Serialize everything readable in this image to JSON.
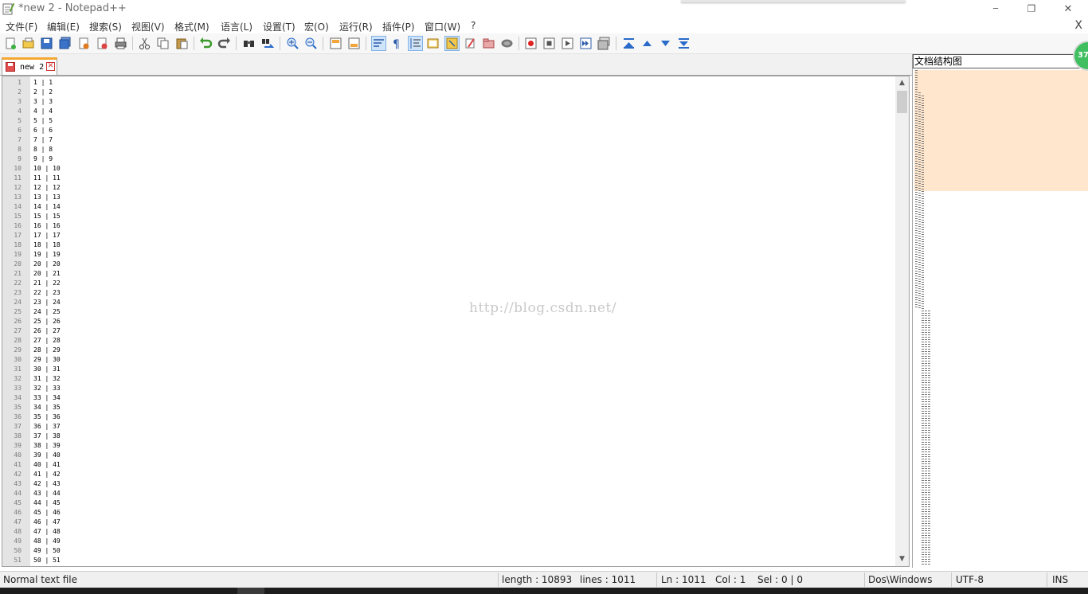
{
  "window": {
    "title": "*new 2 - Notepad++",
    "minimize_symbol": "─",
    "restore_symbol": "❐",
    "close_symbol": "✕"
  },
  "menu": {
    "items": [
      "文件(F)",
      "编辑(E)",
      "搜索(S)",
      "视图(V)",
      "格式(M)",
      "语言(L)",
      "设置(T)",
      "宏(O)",
      "运行(R)",
      "插件(P)",
      "窗口(W)",
      "?"
    ],
    "close_label": "X"
  },
  "toolbar": {
    "icons": [
      "new-file-icon",
      "open-file-icon",
      "save-icon",
      "save-all-icon",
      "close-icon",
      "close-all-icon",
      "print-icon",
      "cut-icon",
      "copy-icon",
      "paste-icon",
      "undo-icon",
      "redo-icon",
      "find-icon",
      "replace-icon",
      "zoom-in-icon",
      "zoom-out-icon",
      "sync-vertical-icon",
      "sync-horizontal-icon",
      "word-wrap-icon",
      "show-all-chars-icon",
      "indent-guide-icon",
      "doc-map-icon",
      "function-list-icon",
      "folder-workspace-icon",
      "monitor-icon",
      "record-macro-icon",
      "stop-macro-icon",
      "play-macro-icon",
      "run-macro-multiple-icon",
      "save-macro-icon",
      "collapse-icon",
      "prev-icon",
      "next-icon",
      "expand-icon"
    ],
    "active": [
      "word-wrap-icon",
      "indent-guide-icon",
      "doc-map-icon"
    ]
  },
  "tab": {
    "label": "new 2",
    "close_symbol": "✕"
  },
  "editor": {
    "lines": [
      {
        "n": "1",
        "t": "1 | 1"
      },
      {
        "n": "2",
        "t": "2 | 2"
      },
      {
        "n": "3",
        "t": "3 | 3"
      },
      {
        "n": "4",
        "t": "4 | 4"
      },
      {
        "n": "5",
        "t": "5 | 5"
      },
      {
        "n": "6",
        "t": "6 | 6"
      },
      {
        "n": "7",
        "t": "7 | 7"
      },
      {
        "n": "8",
        "t": "8 | 8"
      },
      {
        "n": "9",
        "t": "9 | 9"
      },
      {
        "n": "10",
        "t": "10 | 10"
      },
      {
        "n": "11",
        "t": "11 | 11"
      },
      {
        "n": "12",
        "t": "12 | 12"
      },
      {
        "n": "13",
        "t": "13 | 13"
      },
      {
        "n": "14",
        "t": "14 | 14"
      },
      {
        "n": "15",
        "t": "15 | 15"
      },
      {
        "n": "16",
        "t": "16 | 16"
      },
      {
        "n": "17",
        "t": "17 | 17"
      },
      {
        "n": "18",
        "t": "18 | 18"
      },
      {
        "n": "19",
        "t": "19 | 19"
      },
      {
        "n": "20",
        "t": "20 | 20"
      },
      {
        "n": "21",
        "t": "20 | 21"
      },
      {
        "n": "22",
        "t": "21 | 22"
      },
      {
        "n": "23",
        "t": "22 | 23"
      },
      {
        "n": "24",
        "t": "23 | 24"
      },
      {
        "n": "25",
        "t": "24 | 25"
      },
      {
        "n": "26",
        "t": "25 | 26"
      },
      {
        "n": "27",
        "t": "26 | 27"
      },
      {
        "n": "28",
        "t": "27 | 28"
      },
      {
        "n": "29",
        "t": "28 | 29"
      },
      {
        "n": "30",
        "t": "29 | 30"
      },
      {
        "n": "31",
        "t": "30 | 31"
      },
      {
        "n": "32",
        "t": "31 | 32"
      },
      {
        "n": "33",
        "t": "32 | 33"
      },
      {
        "n": "34",
        "t": "33 | 34"
      },
      {
        "n": "35",
        "t": "34 | 35"
      },
      {
        "n": "36",
        "t": "35 | 36"
      },
      {
        "n": "37",
        "t": "36 | 37"
      },
      {
        "n": "38",
        "t": "37 | 38"
      },
      {
        "n": "39",
        "t": "38 | 39"
      },
      {
        "n": "40",
        "t": "39 | 40"
      },
      {
        "n": "41",
        "t": "40 | 41"
      },
      {
        "n": "42",
        "t": "41 | 42"
      },
      {
        "n": "43",
        "t": "42 | 43"
      },
      {
        "n": "44",
        "t": "43 | 44"
      },
      {
        "n": "45",
        "t": "44 | 45"
      },
      {
        "n": "46",
        "t": "45 | 46"
      },
      {
        "n": "47",
        "t": "46 | 47"
      },
      {
        "n": "48",
        "t": "47 | 48"
      },
      {
        "n": "49",
        "t": "48 | 49"
      },
      {
        "n": "50",
        "t": "49 | 50"
      },
      {
        "n": "51",
        "t": "50 | 51"
      }
    ],
    "watermark": "http://blog.csdn.net/"
  },
  "docmap": {
    "title": "文档结构图",
    "view_color": "#ffe6cc"
  },
  "badge": {
    "text": "37"
  },
  "status": {
    "file_type": "Normal text file",
    "length": "length : 10893",
    "lines": "lines : 1011",
    "ln": "Ln : 1011",
    "col": "Col : 1",
    "sel": "Sel : 0 | 0",
    "eol": "Dos\\Windows",
    "encoding": "UTF-8",
    "mode": "INS"
  },
  "colors": {
    "tab_accent": "#f6a732",
    "docmap_view": "#ffe6cc",
    "badge": "#3fbf5f",
    "toolbar_active": "#cde4fb"
  }
}
